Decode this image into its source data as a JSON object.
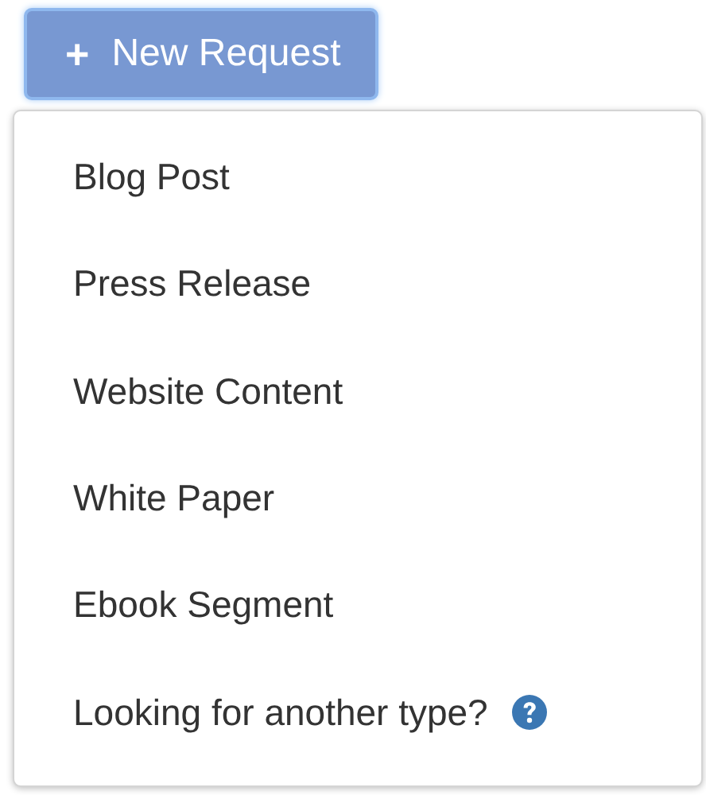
{
  "new_request_button": {
    "icon": "+",
    "label": "New Request"
  },
  "menu": {
    "items": [
      {
        "kind": "option",
        "label": "Blog Post"
      },
      {
        "kind": "option",
        "label": "Press Release"
      },
      {
        "kind": "option",
        "label": "Website Content"
      },
      {
        "kind": "option",
        "label": "White Paper"
      },
      {
        "kind": "option",
        "label": "Ebook Segment"
      },
      {
        "kind": "help",
        "label": "Looking for another type?"
      }
    ]
  }
}
